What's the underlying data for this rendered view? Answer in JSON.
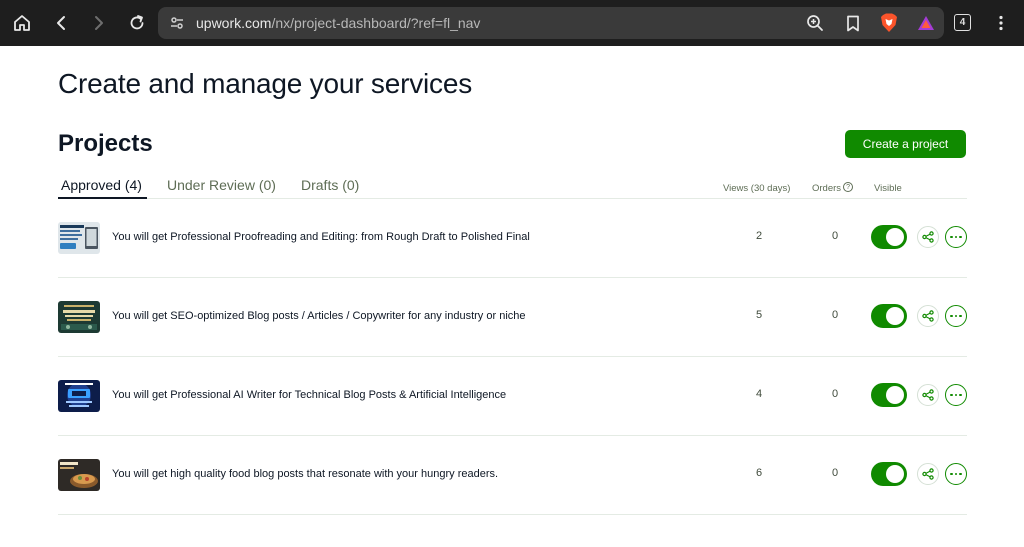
{
  "browser": {
    "url_domain": "upwork.com",
    "url_path": "/nx/project-dashboard/?ref=fl_nav",
    "tab_count": "4",
    "icons": [
      "home-icon",
      "back-icon",
      "forward-icon",
      "reload-icon",
      "site-settings-icon",
      "zoom-icon",
      "bookmark-icon",
      "brave-shield-icon",
      "brave-rewards-icon",
      "tab-count-icon",
      "menu-icon"
    ]
  },
  "page": {
    "title": "Create and manage your services",
    "section_title": "Projects",
    "create_button": "Create a project",
    "accent_color": "#108a00"
  },
  "tabs": [
    {
      "label": "Approved (4)",
      "active": true
    },
    {
      "label": "Under Review (0)",
      "active": false
    },
    {
      "label": "Drafts (0)",
      "active": false
    }
  ],
  "columns": {
    "views": "Views (30 days)",
    "orders": "Orders",
    "visible": "Visible"
  },
  "projects": [
    {
      "title": "You will get Professional Proofreading and Editing: from Rough Draft to Polished Final",
      "views": "2",
      "orders": "0",
      "visible": true
    },
    {
      "title": "You will get SEO-optimized Blog posts / Articles / Copywriter for any industry or niche",
      "views": "5",
      "orders": "0",
      "visible": true
    },
    {
      "title": "You will get Professional AI Writer for Technical Blog Posts & Artificial Intelligence",
      "views": "4",
      "orders": "0",
      "visible": true
    },
    {
      "title": "You will get high quality food blog posts that resonate with your hungry readers.",
      "views": "6",
      "orders": "0",
      "visible": true
    }
  ]
}
